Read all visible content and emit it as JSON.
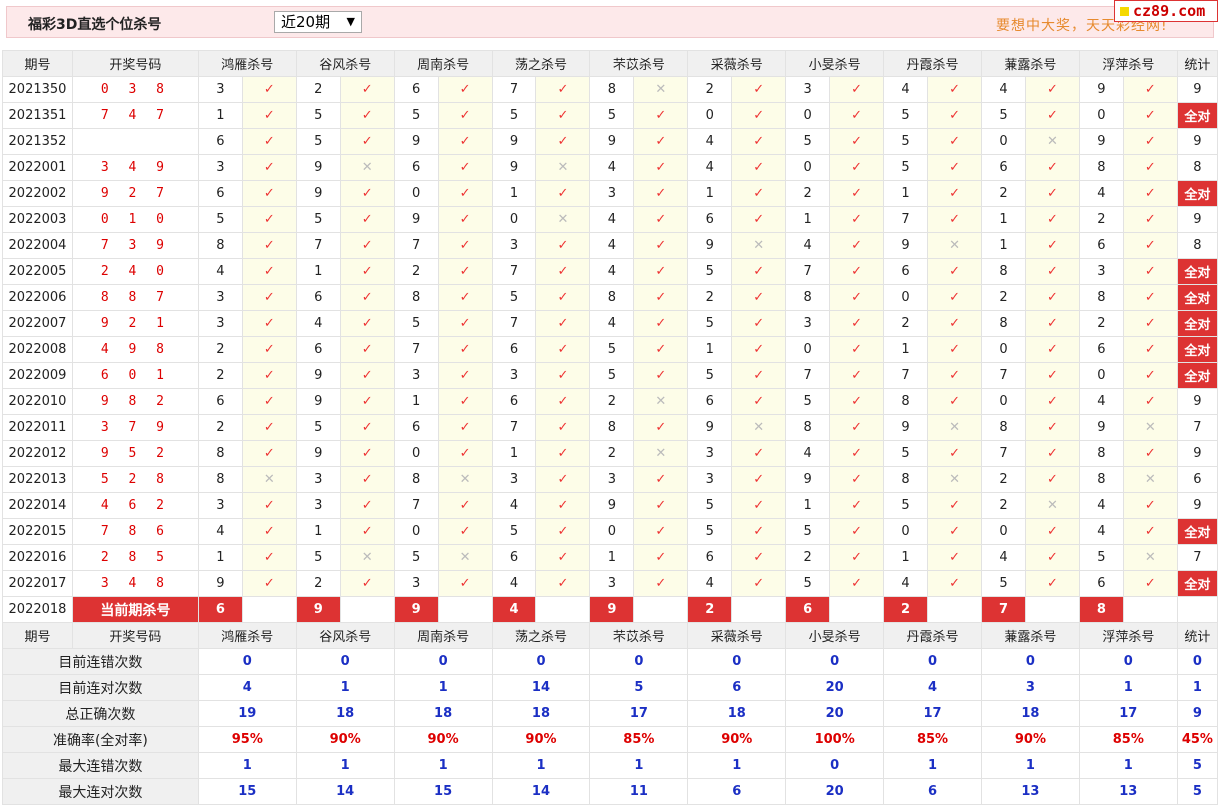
{
  "header": {
    "title": "福彩3D直选个位杀号",
    "period_select": "近20期",
    "slogan": "要想中大奖，天天彩经网!",
    "logo_text": "cz89.com"
  },
  "columns": {
    "period": "期号",
    "draw": "开奖号码",
    "experts": [
      "鸿雁杀号",
      "谷风杀号",
      "周南杀号",
      "荡之杀号",
      "芣苡杀号",
      "采薇杀号",
      "小旻杀号",
      "丹霞杀号",
      "蒹露杀号",
      "浮萍杀号"
    ],
    "stat": "统计"
  },
  "rows": [
    {
      "period": "2021350",
      "draw": "0 3 8",
      "kills": [
        "3",
        "2",
        "6",
        "7",
        "8",
        "2",
        "3",
        "4",
        "4",
        "9"
      ],
      "marks": [
        "ok",
        "ok",
        "ok",
        "ok",
        "bad",
        "ok",
        "ok",
        "ok",
        "ok",
        "ok"
      ],
      "stat": "9"
    },
    {
      "period": "2021351",
      "draw": "7 4 7",
      "kills": [
        "1",
        "5",
        "5",
        "5",
        "5",
        "0",
        "0",
        "5",
        "5",
        "0"
      ],
      "marks": [
        "ok",
        "ok",
        "ok",
        "ok",
        "ok",
        "ok",
        "ok",
        "ok",
        "ok",
        "ok"
      ],
      "stat": "全对"
    },
    {
      "period": "2021352",
      "draw": "",
      "kills": [
        "6",
        "5",
        "9",
        "9",
        "9",
        "4",
        "5",
        "5",
        "0",
        "9"
      ],
      "marks": [
        "ok",
        "ok",
        "ok",
        "ok",
        "ok",
        "ok",
        "ok",
        "ok",
        "bad",
        "ok"
      ],
      "stat": "9"
    },
    {
      "period": "2022001",
      "draw": "3 4 9",
      "kills": [
        "3",
        "9",
        "6",
        "9",
        "4",
        "4",
        "0",
        "5",
        "6",
        "8"
      ],
      "marks": [
        "ok",
        "bad",
        "ok",
        "bad",
        "ok",
        "ok",
        "ok",
        "ok",
        "ok",
        "ok"
      ],
      "stat": "8"
    },
    {
      "period": "2022002",
      "draw": "9 2 7",
      "kills": [
        "6",
        "9",
        "0",
        "1",
        "3",
        "1",
        "2",
        "1",
        "2",
        "4"
      ],
      "marks": [
        "ok",
        "ok",
        "ok",
        "ok",
        "ok",
        "ok",
        "ok",
        "ok",
        "ok",
        "ok"
      ],
      "stat": "全对"
    },
    {
      "period": "2022003",
      "draw": "0 1 0",
      "kills": [
        "5",
        "5",
        "9",
        "0",
        "4",
        "6",
        "1",
        "7",
        "1",
        "2"
      ],
      "marks": [
        "ok",
        "ok",
        "ok",
        "bad",
        "ok",
        "ok",
        "ok",
        "ok",
        "ok",
        "ok"
      ],
      "stat": "9"
    },
    {
      "period": "2022004",
      "draw": "7 3 9",
      "kills": [
        "8",
        "7",
        "7",
        "3",
        "4",
        "9",
        "4",
        "9",
        "1",
        "6"
      ],
      "marks": [
        "ok",
        "ok",
        "ok",
        "ok",
        "ok",
        "bad",
        "ok",
        "bad",
        "ok",
        "ok"
      ],
      "stat": "8"
    },
    {
      "period": "2022005",
      "draw": "2 4 0",
      "kills": [
        "4",
        "1",
        "2",
        "7",
        "4",
        "5",
        "7",
        "6",
        "8",
        "3"
      ],
      "marks": [
        "ok",
        "ok",
        "ok",
        "ok",
        "ok",
        "ok",
        "ok",
        "ok",
        "ok",
        "ok"
      ],
      "stat": "全对"
    },
    {
      "period": "2022006",
      "draw": "8 8 7",
      "kills": [
        "3",
        "6",
        "8",
        "5",
        "8",
        "2",
        "8",
        "0",
        "2",
        "8"
      ],
      "marks": [
        "ok",
        "ok",
        "ok",
        "ok",
        "ok",
        "ok",
        "ok",
        "ok",
        "ok",
        "ok"
      ],
      "stat": "全对"
    },
    {
      "period": "2022007",
      "draw": "9 2 1",
      "kills": [
        "3",
        "4",
        "5",
        "7",
        "4",
        "5",
        "3",
        "2",
        "8",
        "2"
      ],
      "marks": [
        "ok",
        "ok",
        "ok",
        "ok",
        "ok",
        "ok",
        "ok",
        "ok",
        "ok",
        "ok"
      ],
      "stat": "全对"
    },
    {
      "period": "2022008",
      "draw": "4 9 8",
      "kills": [
        "2",
        "6",
        "7",
        "6",
        "5",
        "1",
        "0",
        "1",
        "0",
        "6"
      ],
      "marks": [
        "ok",
        "ok",
        "ok",
        "ok",
        "ok",
        "ok",
        "ok",
        "ok",
        "ok",
        "ok"
      ],
      "stat": "全对"
    },
    {
      "period": "2022009",
      "draw": "6 0 1",
      "kills": [
        "2",
        "9",
        "3",
        "3",
        "5",
        "5",
        "7",
        "7",
        "7",
        "0"
      ],
      "marks": [
        "ok",
        "ok",
        "ok",
        "ok",
        "ok",
        "ok",
        "ok",
        "ok",
        "ok",
        "ok"
      ],
      "stat": "全对"
    },
    {
      "period": "2022010",
      "draw": "9 8 2",
      "kills": [
        "6",
        "9",
        "1",
        "6",
        "2",
        "6",
        "5",
        "8",
        "0",
        "4"
      ],
      "marks": [
        "ok",
        "ok",
        "ok",
        "ok",
        "bad",
        "ok",
        "ok",
        "ok",
        "ok",
        "ok"
      ],
      "stat": "9"
    },
    {
      "period": "2022011",
      "draw": "3 7 9",
      "kills": [
        "2",
        "5",
        "6",
        "7",
        "8",
        "9",
        "8",
        "9",
        "8",
        "9"
      ],
      "marks": [
        "ok",
        "ok",
        "ok",
        "ok",
        "ok",
        "bad",
        "ok",
        "bad",
        "ok",
        "bad"
      ],
      "stat": "7"
    },
    {
      "period": "2022012",
      "draw": "9 5 2",
      "kills": [
        "8",
        "9",
        "0",
        "1",
        "2",
        "3",
        "4",
        "5",
        "7",
        "8"
      ],
      "marks": [
        "ok",
        "ok",
        "ok",
        "ok",
        "bad",
        "ok",
        "ok",
        "ok",
        "ok",
        "ok"
      ],
      "stat": "9"
    },
    {
      "period": "2022013",
      "draw": "5 2 8",
      "kills": [
        "8",
        "3",
        "8",
        "3",
        "3",
        "3",
        "9",
        "8",
        "2",
        "8"
      ],
      "marks": [
        "bad",
        "ok",
        "bad",
        "ok",
        "ok",
        "ok",
        "ok",
        "bad",
        "ok",
        "bad"
      ],
      "stat": "6"
    },
    {
      "period": "2022014",
      "draw": "4 6 2",
      "kills": [
        "3",
        "3",
        "7",
        "4",
        "9",
        "5",
        "1",
        "5",
        "2",
        "4"
      ],
      "marks": [
        "ok",
        "ok",
        "ok",
        "ok",
        "ok",
        "ok",
        "ok",
        "ok",
        "bad",
        "ok"
      ],
      "stat": "9"
    },
    {
      "period": "2022015",
      "draw": "7 8 6",
      "kills": [
        "4",
        "1",
        "0",
        "5",
        "0",
        "5",
        "5",
        "0",
        "0",
        "4"
      ],
      "marks": [
        "ok",
        "ok",
        "ok",
        "ok",
        "ok",
        "ok",
        "ok",
        "ok",
        "ok",
        "ok"
      ],
      "stat": "全对"
    },
    {
      "period": "2022016",
      "draw": "2 8 5",
      "kills": [
        "1",
        "5",
        "5",
        "6",
        "1",
        "6",
        "2",
        "1",
        "4",
        "5"
      ],
      "marks": [
        "ok",
        "bad",
        "bad",
        "ok",
        "ok",
        "ok",
        "ok",
        "ok",
        "ok",
        "bad"
      ],
      "stat": "7"
    },
    {
      "period": "2022017",
      "draw": "3 4 8",
      "kills": [
        "9",
        "2",
        "3",
        "4",
        "3",
        "4",
        "5",
        "4",
        "5",
        "6"
      ],
      "marks": [
        "ok",
        "ok",
        "ok",
        "ok",
        "ok",
        "ok",
        "ok",
        "ok",
        "ok",
        "ok"
      ],
      "stat": "全对"
    }
  ],
  "current": {
    "period": "2022018",
    "label": "当前期杀号",
    "kills": [
      "6",
      "9",
      "9",
      "4",
      "9",
      "2",
      "6",
      "2",
      "7",
      "8"
    ]
  },
  "summary": [
    {
      "label": "目前连错次数",
      "values": [
        "0",
        "0",
        "0",
        "0",
        "0",
        "0",
        "0",
        "0",
        "0",
        "0"
      ],
      "stat": "0",
      "color": "blue"
    },
    {
      "label": "目前连对次数",
      "values": [
        "4",
        "1",
        "1",
        "14",
        "5",
        "6",
        "20",
        "4",
        "3",
        "1"
      ],
      "stat": "1",
      "color": "blue"
    },
    {
      "label": "总正确次数",
      "values": [
        "19",
        "18",
        "18",
        "18",
        "17",
        "18",
        "20",
        "17",
        "18",
        "17"
      ],
      "stat": "9",
      "color": "blue"
    },
    {
      "label": "准确率(全对率)",
      "values": [
        "95%",
        "90%",
        "90%",
        "90%",
        "85%",
        "90%",
        "100%",
        "85%",
        "90%",
        "85%"
      ],
      "stat": "45%",
      "color": "red"
    },
    {
      "label": "最大连错次数",
      "values": [
        "1",
        "1",
        "1",
        "1",
        "1",
        "1",
        "0",
        "1",
        "1",
        "1"
      ],
      "stat": "5",
      "color": "blue"
    },
    {
      "label": "最大连对次数",
      "values": [
        "15",
        "14",
        "15",
        "14",
        "11",
        "6",
        "20",
        "6",
        "13",
        "13"
      ],
      "stat": "5",
      "color": "blue"
    }
  ],
  "symbols": {
    "ok": "✓",
    "bad": "✕"
  },
  "colors": {
    "accent": "#d33",
    "correct": "#e33",
    "wrong": "#bbb",
    "count": "#1b2fc4",
    "rate": "#d00"
  }
}
